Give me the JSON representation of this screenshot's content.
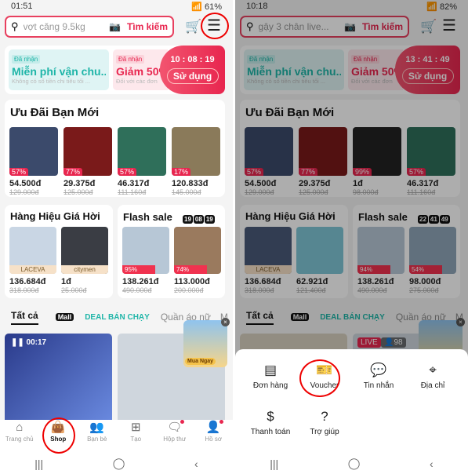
{
  "colors": {
    "accent": "#e8264f",
    "teal": "#1fb5a8",
    "annotation": "#e00000"
  },
  "panels": [
    {
      "status": {
        "time": "01:51",
        "battery": "61%"
      },
      "search": {
        "placeholder": "vợt căng 9.5kg",
        "button": "Tìm kiếm"
      },
      "voucher": {
        "free_tag": "Đã nhận",
        "free_title": "Miễn phí vận chu...",
        "free_sub": "Không có số tiền chi tiêu tối ...",
        "disc_tag": "Đã nhận",
        "disc_title": "Giảm 50%",
        "disc_sub": "Đối với các đơn",
        "timer": "10 : 08 : 19",
        "use": "Sử dụng"
      },
      "new_user": {
        "title": "Ưu Đãi Bạn Mới",
        "items": [
          {
            "discount": "57%",
            "price": "54.500đ",
            "old": "129.000đ",
            "color": "#3b4a6b"
          },
          {
            "discount": "77%",
            "price": "29.375đ",
            "old": "125.000đ",
            "color": "#7a1a1a"
          },
          {
            "discount": "57%",
            "price": "46.317đ",
            "old": "111.160đ",
            "color": "#2f6f5a"
          },
          {
            "discount": "17%",
            "price": "120.833đ",
            "old": "145.000đ",
            "color": "#8a7a5a"
          }
        ]
      },
      "brand": {
        "title": "Hàng Hiệu Giá Hời",
        "items": [
          {
            "label": "LACEVA",
            "price": "136.684đ",
            "old": "318.000đ",
            "color": "#c9d6e4"
          },
          {
            "label": "citymen",
            "price": "1đ",
            "old": "25.000đ",
            "color": "#3a3d44"
          }
        ]
      },
      "flash": {
        "title": "Flash sale",
        "timer": [
          "19",
          "08",
          "19"
        ],
        "items": [
          {
            "percent": "95%",
            "price": "138.261đ",
            "old": "490.000đ",
            "color": "#b7c7d6"
          },
          {
            "percent": "74%",
            "price": "113.000đ",
            "old": "200.000đ",
            "color": "#9a7a5e"
          }
        ]
      },
      "tabs": [
        "Tất cả",
        "Mall",
        "DEAL BÁN CHẠY",
        "Quần áo nữ",
        "M"
      ],
      "feed": {
        "video_time": "00:17",
        "promo": "Mua Ngay"
      },
      "nav": [
        {
          "label": "Trang chủ",
          "icon": "home-icon"
        },
        {
          "label": "Shop",
          "icon": "shopping-bag-icon"
        },
        {
          "label": "Bạn bè",
          "icon": "friends-icon"
        },
        {
          "label": "Tạo",
          "icon": "create-icon"
        },
        {
          "label": "Hộp thư",
          "icon": "inbox-icon"
        },
        {
          "label": "Hồ sơ",
          "icon": "profile-icon"
        }
      ]
    },
    {
      "status": {
        "time": "10:18",
        "battery": "82%"
      },
      "search": {
        "placeholder": "gậy 3 chân live...",
        "button": "Tìm kiếm"
      },
      "voucher": {
        "free_tag": "Đã nhận",
        "free_title": "Miễn phí vận chu...",
        "free_sub": "Không có số tiền chi tiêu tối ...",
        "disc_tag": "Đã nhận",
        "disc_title": "Giảm 50%",
        "disc_sub": "Đối với các đơn",
        "timer": "13 : 41 : 49",
        "use": "Sử dụng"
      },
      "new_user": {
        "title": "Ưu Đãi Bạn Mới",
        "items": [
          {
            "discount": "57%",
            "price": "54.500đ",
            "old": "129.000đ",
            "color": "#3b4a6b"
          },
          {
            "discount": "77%",
            "price": "29.375đ",
            "old": "125.000đ",
            "color": "#7a1a1a"
          },
          {
            "discount": "99%",
            "price": "1đ",
            "old": "98.000đ",
            "color": "#222222"
          },
          {
            "discount": "57%",
            "price": "46.317đ",
            "old": "111.160đ",
            "color": "#2f6f5a"
          }
        ]
      },
      "brand": {
        "title": "Hàng Hiệu Giá Hời",
        "items": [
          {
            "label": "LACEVA",
            "price": "136.684đ",
            "old": "318.000đ",
            "color": "#4a5a7a"
          },
          {
            "label": "",
            "price": "62.921đ",
            "old": "121.400đ",
            "color": "#7fc6d6"
          }
        ]
      },
      "flash": {
        "title": "Flash sale",
        "timer": [
          "22",
          "41",
          "49"
        ],
        "items": [
          {
            "percent": "94%",
            "price": "138.261đ",
            "old": "490.000đ",
            "color": "#b7c7d6"
          },
          {
            "percent": "54%",
            "price": "98.000đ",
            "old": "275.000đ",
            "color": "#8fa6b8"
          }
        ]
      },
      "tabs": [
        "Tất cả",
        "Mall",
        "DEAL BÁN CHẠY",
        "Quần áo nữ",
        "M"
      ],
      "feed": {
        "live": "LIVE",
        "viewers": "98"
      },
      "sheet": [
        {
          "label": "Đơn hàng",
          "icon": "order-list-icon",
          "glyph": "▤"
        },
        {
          "label": "Voucher",
          "icon": "voucher-ticket-icon",
          "glyph": "🎫"
        },
        {
          "label": "Tin nhắn",
          "icon": "message-icon",
          "glyph": "💬"
        },
        {
          "label": "Địa chỉ",
          "icon": "location-pin-icon",
          "glyph": "⌖"
        },
        {
          "label": "Thanh toán",
          "icon": "payment-dollar-icon",
          "glyph": "$"
        },
        {
          "label": "Trợ giúp",
          "icon": "help-icon",
          "glyph": "?"
        }
      ]
    }
  ]
}
